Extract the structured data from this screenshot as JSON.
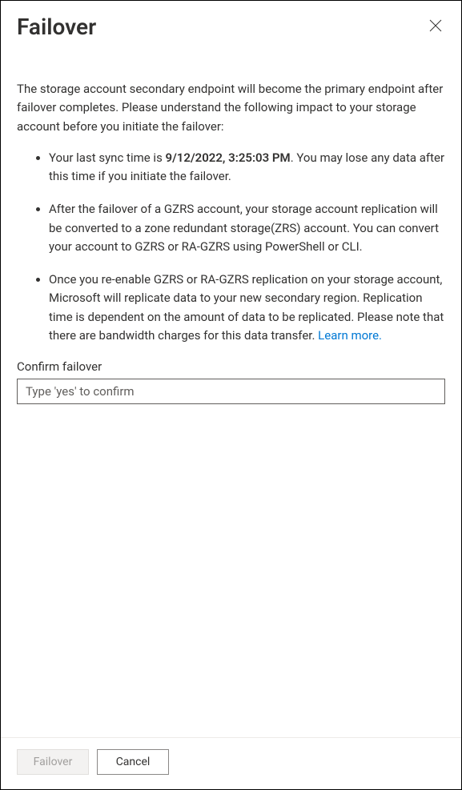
{
  "header": {
    "title": "Failover"
  },
  "body": {
    "intro": "The storage account secondary endpoint will become the primary endpoint after failover completes. Please understand the following impact to your storage account before you initiate the failover:",
    "bullet1_prefix": "Your last sync time is ",
    "bullet1_bold": "9/12/2022, 3:25:03 PM",
    "bullet1_suffix": ". You may lose any data after this time if you initiate the failover.",
    "bullet2": "After the failover of a GZRS account, your storage account replication will be converted to a zone redundant storage(ZRS) account. You can convert your account to GZRS or RA-GZRS using PowerShell or CLI.",
    "bullet3_text": "Once you re-enable GZRS or RA-GZRS replication on your storage account, Microsoft will replicate data to your new secondary region. Replication time is dependent on the amount of data to be replicated. Please note that there are bandwidth charges for this data transfer. ",
    "bullet3_link": "Learn more.",
    "confirm_label": "Confirm failover",
    "confirm_placeholder": "Type 'yes' to confirm"
  },
  "footer": {
    "failover_label": "Failover",
    "cancel_label": "Cancel"
  }
}
